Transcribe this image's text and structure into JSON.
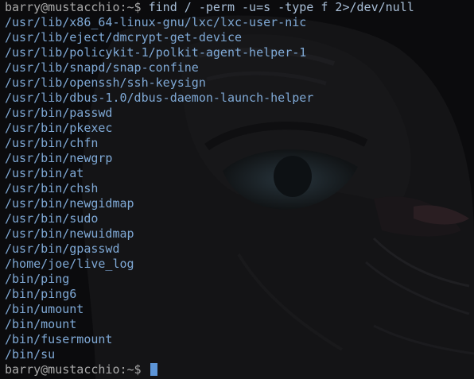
{
  "terminal": {
    "prompt": "barry@mustacchio:~$",
    "command": "find / -perm -u=s -type f 2>/dev/null",
    "output": [
      "/usr/lib/x86_64-linux-gnu/lxc/lxc-user-nic",
      "/usr/lib/eject/dmcrypt-get-device",
      "/usr/lib/policykit-1/polkit-agent-helper-1",
      "/usr/lib/snapd/snap-confine",
      "/usr/lib/openssh/ssh-keysign",
      "/usr/lib/dbus-1.0/dbus-daemon-launch-helper",
      "/usr/bin/passwd",
      "/usr/bin/pkexec",
      "/usr/bin/chfn",
      "/usr/bin/newgrp",
      "/usr/bin/at",
      "/usr/bin/chsh",
      "/usr/bin/newgidmap",
      "/usr/bin/sudo",
      "/usr/bin/newuidmap",
      "/usr/bin/gpasswd",
      "/home/joe/live_log",
      "/bin/ping",
      "/bin/ping6",
      "/bin/umount",
      "/bin/mount",
      "/bin/fusermount",
      "/bin/su"
    ],
    "final_prompt": "barry@mustacchio:~$"
  },
  "colors": {
    "background": "#0b0b0d",
    "prompt": "#a9a9a9",
    "output": "#7fa9d6",
    "cursor": "#5d95d8"
  },
  "icons": {
    "wallpaper": "cat-face-wallpaper-icon",
    "cursor": "block-cursor-icon"
  }
}
